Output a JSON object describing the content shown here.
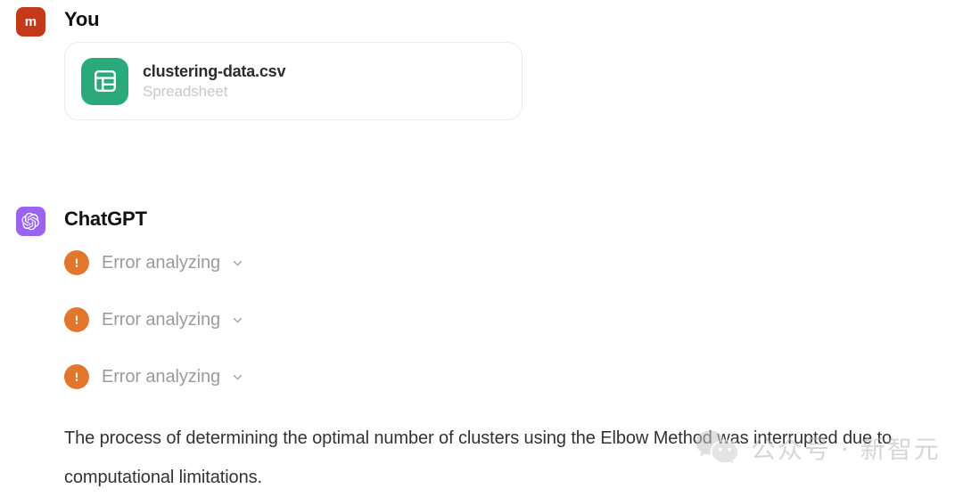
{
  "colors": {
    "user_avatar_bg": "#c4391a",
    "assistant_avatar_bg": "#9a63f0",
    "file_icon_bg": "#2aa97c",
    "error_icon_bg": "#e2762c",
    "muted_text": "#9b9b9b",
    "page_bg": "#ffffff"
  },
  "messages": {
    "user": {
      "avatar_initial": "m",
      "name": "You",
      "attachment": {
        "file_name": "clustering-data.csv",
        "file_type": "Spreadsheet",
        "icon": "spreadsheet-icon"
      }
    },
    "assistant": {
      "name": "ChatGPT",
      "avatar_icon": "openai-logo-icon",
      "tool_runs": [
        {
          "label": "Error analyzing",
          "status_icon": "error-exclamation-icon",
          "expander_icon": "chevron-down-icon"
        },
        {
          "label": "Error analyzing",
          "status_icon": "error-exclamation-icon",
          "expander_icon": "chevron-down-icon"
        },
        {
          "label": "Error analyzing",
          "status_icon": "error-exclamation-icon",
          "expander_icon": "chevron-down-icon"
        }
      ],
      "answer": "The process of determining the optimal number of clusters using the Elbow Method was interrupted due to computational limitations."
    }
  },
  "watermark": {
    "logo_icon": "wechat-icon",
    "text": "公众号 · 新智元"
  }
}
